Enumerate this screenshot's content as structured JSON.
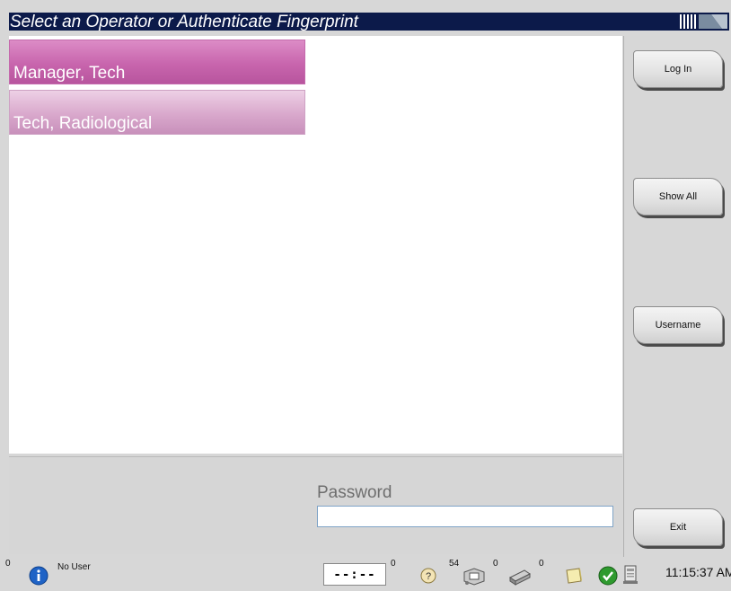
{
  "header": {
    "title": "Select an Operator or Authenticate Fingerprint"
  },
  "operators": [
    {
      "label": "Manager, Tech"
    },
    {
      "label": "Tech, Radiological"
    }
  ],
  "password": {
    "label": "Password",
    "value": ""
  },
  "sidebar": {
    "login_label": "Log In",
    "show_all_label": "Show All",
    "username_label": "Username",
    "exit_label": "Exit"
  },
  "status": {
    "alerts_count": "0",
    "user": "No User",
    "timer": "--:--",
    "timer_count": "0",
    "queue_count": "54",
    "archive_count": "0",
    "print_count": "0",
    "time": "11:15:37 AM",
    "icons": [
      "info-icon",
      "help-icon",
      "queue-icon",
      "printer-icon",
      "notes-icon",
      "status-ok-icon",
      "output-icon"
    ]
  },
  "colors": {
    "title_bg": "#0c1a4a",
    "operator_selected": "#c865ad",
    "operator_normal": "#d9a8cc",
    "status_ok": "#2e9a2e"
  }
}
